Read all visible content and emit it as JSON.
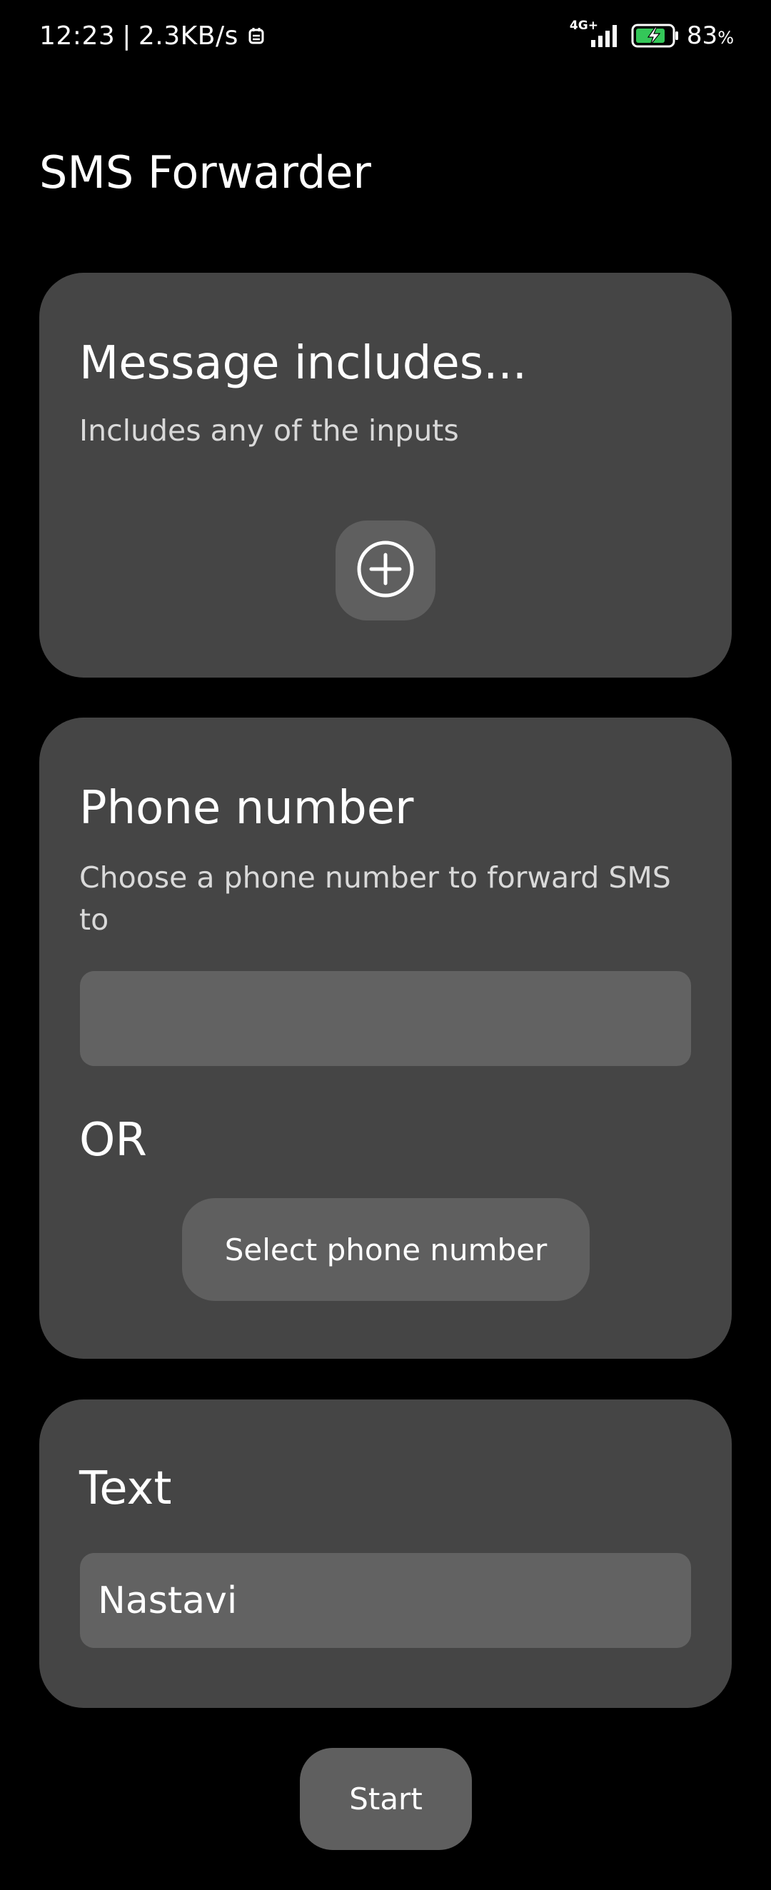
{
  "status_bar": {
    "time": "12:23",
    "separator": "|",
    "speed": "2.3KB/s",
    "network": "4G+",
    "battery": "83",
    "battery_unit": "%",
    "icons": [
      "notification-icon",
      "signal-icon",
      "battery-charging-icon"
    ]
  },
  "app": {
    "title": "SMS Forwarder"
  },
  "includes_card": {
    "title": "Message includes...",
    "subtitle": "Includes any of the inputs",
    "add_icon": "add-circle-icon"
  },
  "phone_card": {
    "title": "Phone number",
    "subtitle": "Choose a phone number to forward SMS to",
    "phone_value": "",
    "or_label": "OR",
    "select_button": "Select phone number"
  },
  "text_card": {
    "title": "Text",
    "text_value": "Nastavi"
  },
  "actions": {
    "start_label": "Start"
  }
}
